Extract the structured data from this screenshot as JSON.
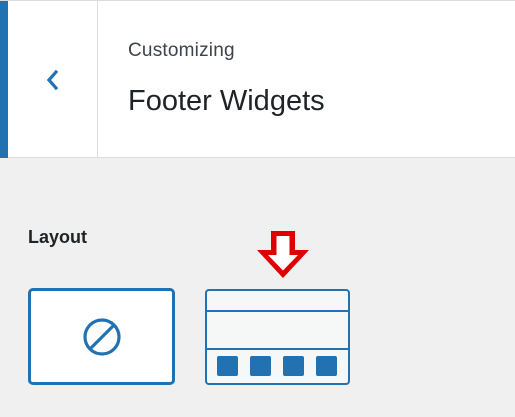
{
  "header": {
    "back_icon": "chevron-left-icon",
    "subtitle": "Customizing",
    "title": "Footer Widgets"
  },
  "layout": {
    "label": "Layout",
    "selected_indicator_icon": "arrow-down-icon",
    "options": [
      {
        "icon": "no-symbol-icon"
      },
      {
        "icon": "four-column-footer-icon",
        "columns": 4
      }
    ]
  },
  "colors": {
    "accent": "#2271b1",
    "indicator": "#e00000",
    "panel_bg": "#f0f0f1",
    "header_bg": "#ffffff"
  }
}
